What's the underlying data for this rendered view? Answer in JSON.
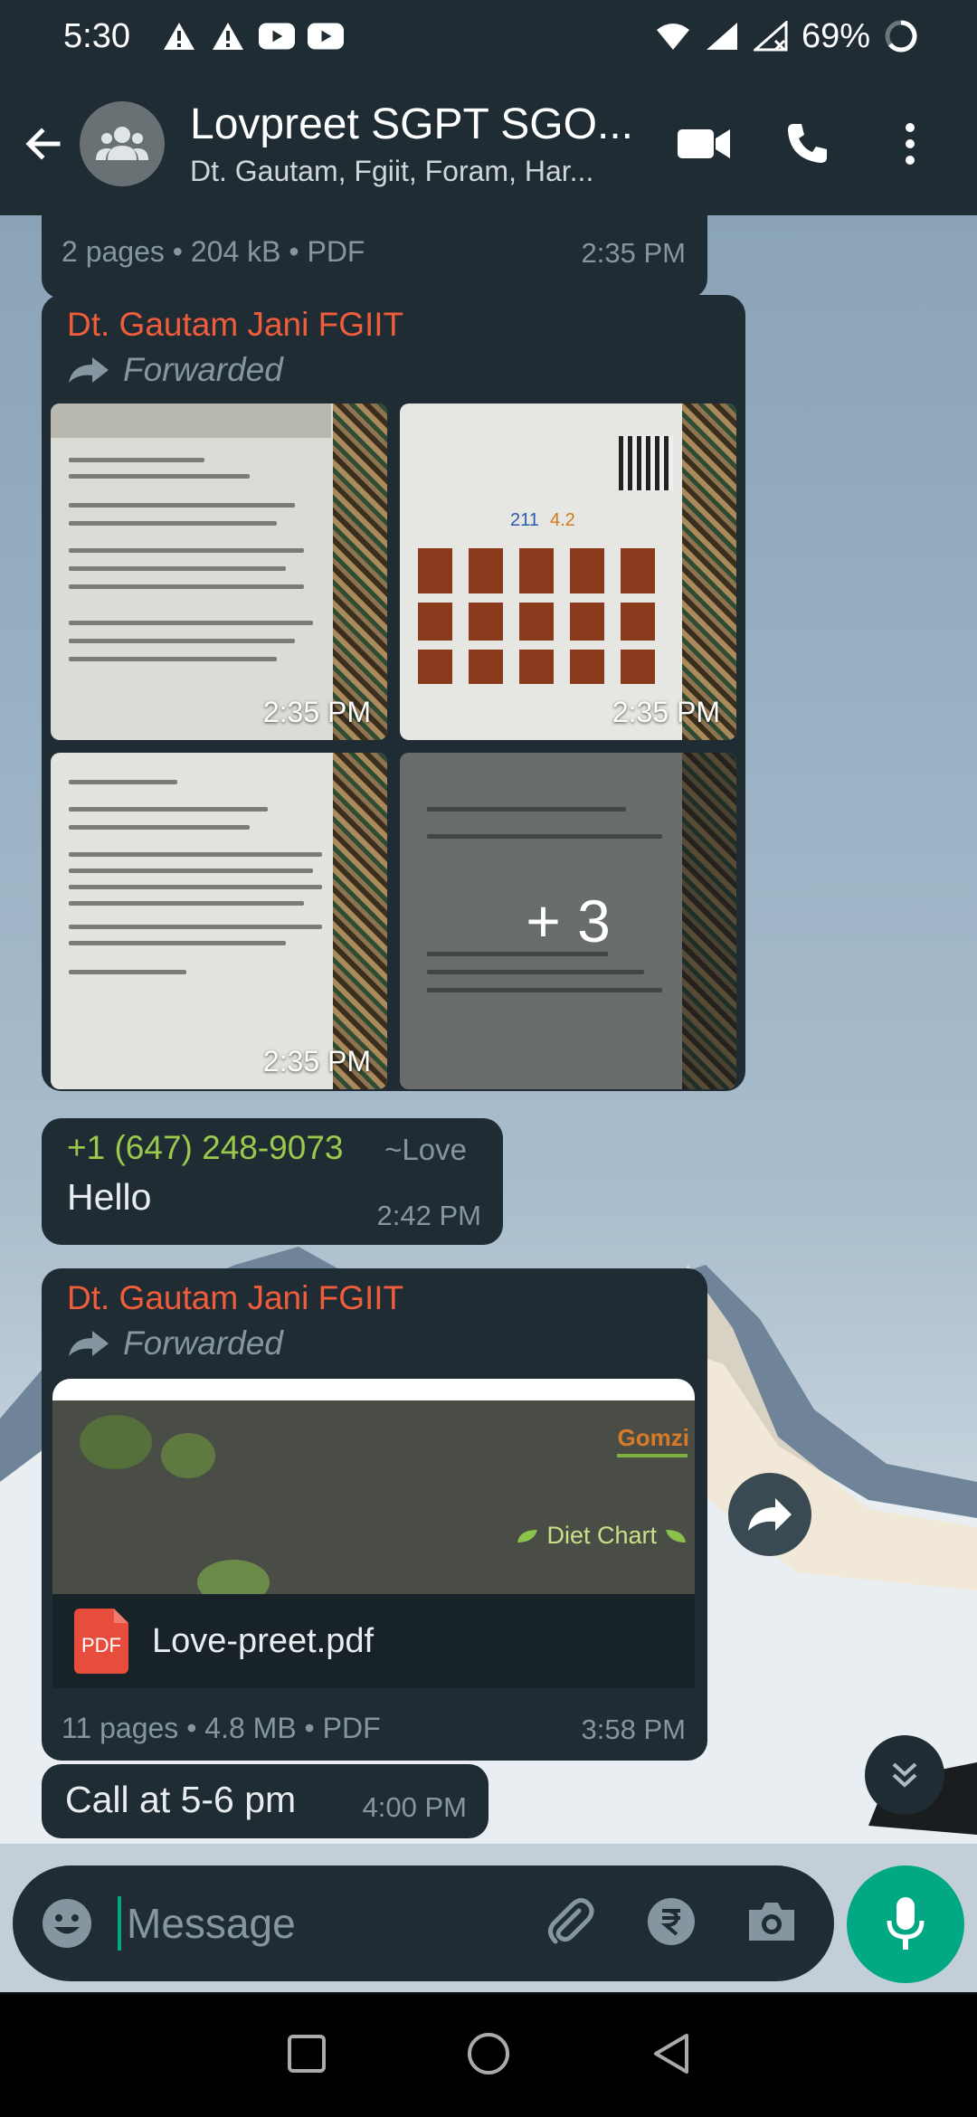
{
  "status_bar": {
    "time": "5:30",
    "battery": "69%",
    "icons": [
      "alert-icon",
      "alert-icon",
      "youtube-icon",
      "youtube-icon",
      "wifi-icon",
      "signal-icon",
      "signal-no-service-icon",
      "battery-icon"
    ]
  },
  "header": {
    "title": "Lovpreet SGPT SGO...",
    "subtitle": "Dt. Gautam, Fgiit, Foram, Har..."
  },
  "messages": {
    "doc_prev": {
      "meta": "2 pages • 204 kB • PDF",
      "time": "2:35 PM"
    },
    "album": {
      "sender": "Dt. Gautam Jani FGIIT",
      "forwarded": "Forwarded",
      "photo_times": [
        "2:35 PM",
        "2:35 PM",
        "2:35 PM"
      ],
      "more": "+ 3"
    },
    "hello": {
      "sender_phone": "+1 (647) 248-9073",
      "sender_name": "~Love",
      "text": "Hello",
      "time": "2:42 PM"
    },
    "pdf": {
      "sender": "Dt. Gautam Jani FGIIT",
      "forwarded": "Forwarded",
      "preview_label": "Diet Chart",
      "file_icon_text": "PDF",
      "filename": "Love-preet.pdf",
      "meta": "11 pages • 4.8 MB • PDF",
      "time": "3:58 PM"
    },
    "call": {
      "text": "Call at 5-6 pm",
      "time": "4:00 PM"
    }
  },
  "input": {
    "placeholder": "Message"
  },
  "colors": {
    "bubble": "#1f2c34",
    "accent": "#00a884",
    "sender_orange": "#f15c3b",
    "sender_green": "#9bc94b"
  }
}
